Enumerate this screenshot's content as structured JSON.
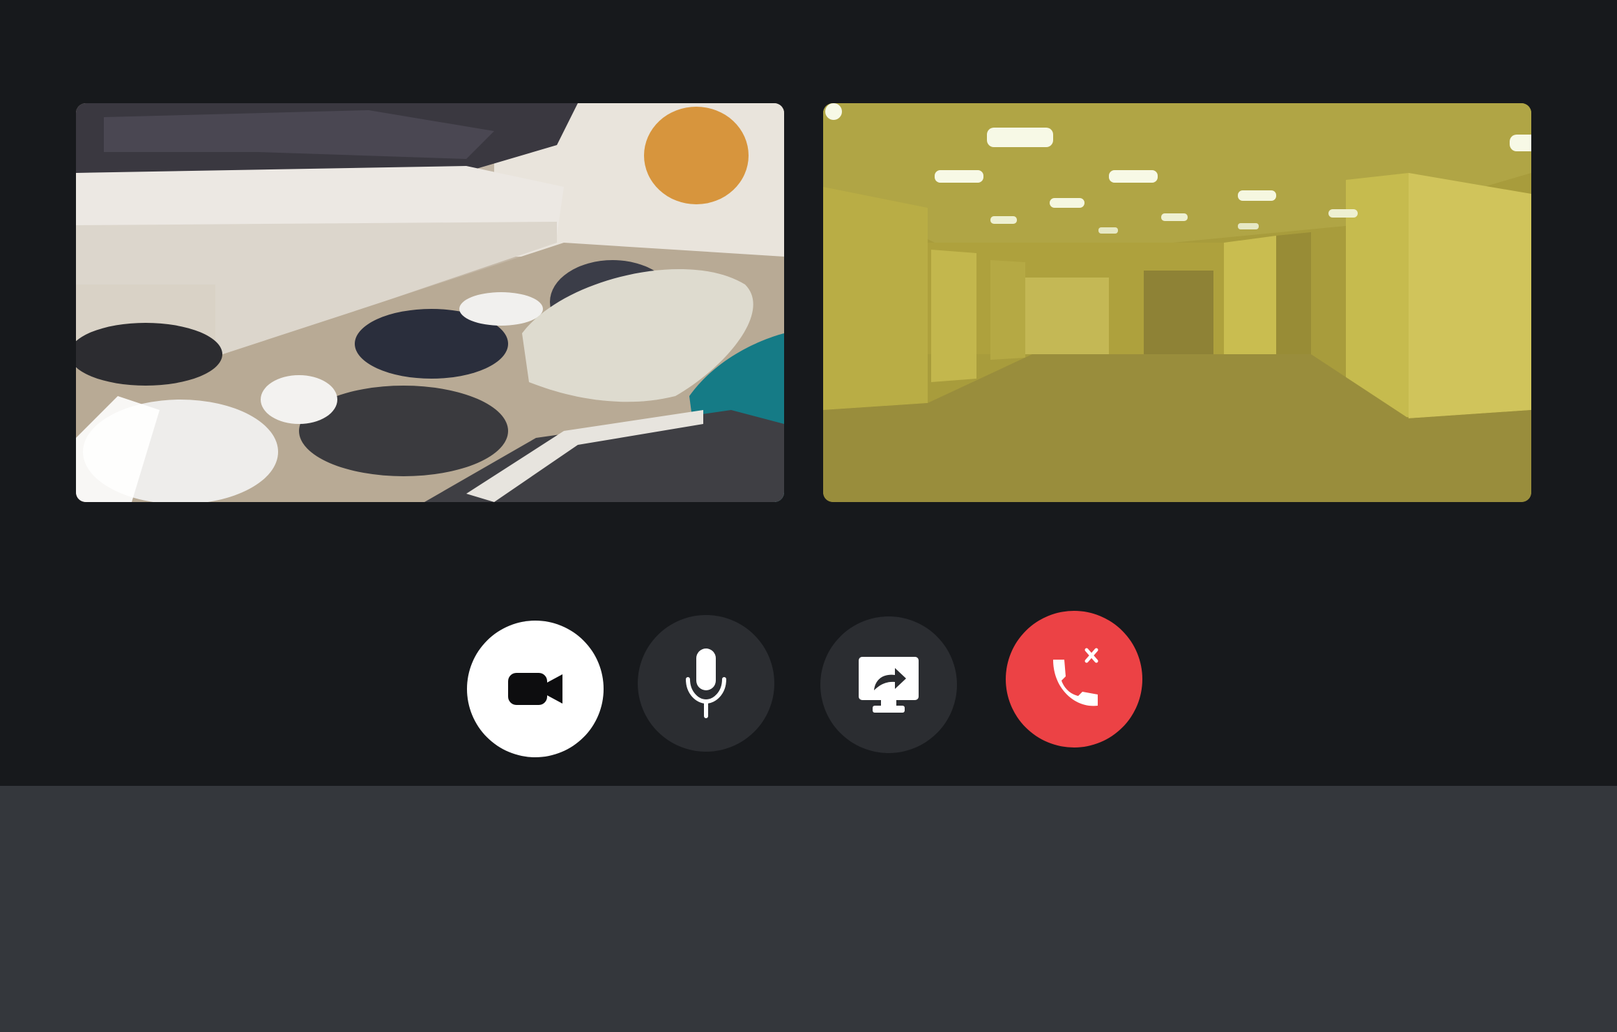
{
  "colors": {
    "stage_background": "#17191c",
    "panel_background": "#34373c",
    "control_dark": "#2b2d31",
    "camera_on": "#ffffff",
    "hangup_red": "#ec4245"
  },
  "participants": [
    {
      "id": "participant-1",
      "video": "on"
    },
    {
      "id": "participant-2",
      "video": "on"
    }
  ],
  "controls": [
    {
      "name": "camera",
      "icon": "video-camera-icon",
      "state": "on"
    },
    {
      "name": "microphone",
      "icon": "microphone-icon",
      "state": "on"
    },
    {
      "name": "screen-share",
      "icon": "screen-share-icon",
      "state": "off"
    },
    {
      "name": "disconnect",
      "icon": "hang-up-phone-icon",
      "state": "active"
    }
  ]
}
